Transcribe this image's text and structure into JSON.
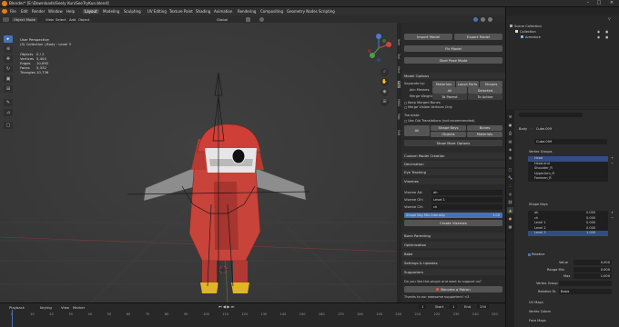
{
  "window": {
    "title": "Blender* [E:\\Downloads\\Seely Kun\\SeeTryKun.blend]"
  },
  "menu": {
    "file_items": [
      "File",
      "Edit",
      "Render",
      "Window",
      "Help"
    ],
    "workspaces": [
      "Layout",
      "Modeling",
      "Sculpting",
      "UV Editing",
      "Texture Paint",
      "Shading",
      "Animation",
      "Rendering",
      "Compositing",
      "Geometry Nodes",
      "Scripting"
    ],
    "active_workspace": "Layout",
    "scene_label": "Scene",
    "viewlayer_label": "ViewLayer"
  },
  "viewport_header": {
    "mode": "Object Mode",
    "items": [
      "View",
      "Select",
      "Add",
      "Object"
    ],
    "orientation": "Global",
    "options": "Options"
  },
  "viewport": {
    "view_name": "User Perspective",
    "collection": "(0) Collection | Body : Level 3",
    "stats": [
      {
        "label": "Objects",
        "value": "0 / 2"
      },
      {
        "label": "Vertices",
        "value": "5,404"
      },
      {
        "label": "Edges",
        "value": "10,692"
      },
      {
        "label": "Faces",
        "value": "5,332"
      },
      {
        "label": "Triangles",
        "value": "10,736"
      }
    ]
  },
  "cats_panel": {
    "import_label": "Import Model",
    "export_label": "Export Model",
    "fix_label": "Fix Model",
    "pose_label": "Start Pose Mode",
    "model_options": "Model Options",
    "separate_by": "Separate by:",
    "sep_materials": "Materials",
    "sep_loose": "Loose Parts",
    "sep_shapes": "Shapes",
    "join_meshes": "Join Meshes:",
    "join_all": "All",
    "join_selected": "Selected",
    "merge_weights": "Merge Weights:",
    "merge_to_parent": "To Parent",
    "merge_to_active": "To Active",
    "keep_merged_bones": "Keep Merged Bones",
    "merge_visible": "Merge Visible Vertices Only",
    "translate": "Translate:",
    "use_old_translations": "Use Old Translations (not recommended)",
    "tr_all": "All",
    "tr_shape_keys": "Shape Keys",
    "tr_bones": "Bones",
    "tr_objects": "Objects",
    "tr_materials": "Materials",
    "show_more": "Show More Options",
    "custom_model": "Custom Model Creation",
    "decimation": "Decimation",
    "eye_tracking": "Eye Tracking",
    "visemes": "Visemes",
    "viseme_aa_label": "Viseme AA:",
    "viseme_aa_value": "ah",
    "viseme_oh_label": "Viseme OH:",
    "viseme_oh_value": "Level 1",
    "viseme_ch_label": "Viseme CH:",
    "viseme_ch_value": "ch",
    "shape_mix_label": "Shape Key Mix Intensity",
    "shape_mix_value": "1.00",
    "create_visemes": "Create Visemes",
    "bone_parenting": "Bone Parenting",
    "optimization": "Optimization",
    "bake": "Bake",
    "settings_updates": "Settings & Updates",
    "supporters": "Supporters",
    "support_question": "Do you like this plugin and want to support us?",
    "patron": "Become a Patron",
    "thanks": "Thanks to our awesome supporters! <3"
  },
  "side_tabs": [
    "Item",
    "Tool",
    "View",
    "CATS",
    "MMD",
    "Misc",
    "Edit"
  ],
  "outliner": {
    "title": "Scene Collection",
    "items": [
      {
        "label": "Collection",
        "depth": 1
      },
      {
        "label": "Armature",
        "depth": 2
      }
    ]
  },
  "properties": {
    "breadcrumb": [
      "Body",
      "Cube.009"
    ],
    "mesh_name": "Cube.009",
    "vertex_groups_title": "Vertex Groups",
    "vertex_groups": [
      "Head",
      "Head.end",
      "Shoulder_R",
      "UpperArm_R",
      "Forearm_R"
    ],
    "shape_keys_title": "Shape Keys",
    "shape_keys": [
      {
        "name": "ah",
        "value": "0.000"
      },
      {
        "name": "ch",
        "value": "0.000"
      },
      {
        "name": "Level 1",
        "value": "0.000"
      },
      {
        "name": "Level 2",
        "value": "0.000"
      },
      {
        "name": "Level 3",
        "value": "1.000"
      }
    ],
    "relative_label": "Relative",
    "value_label": "Value",
    "value": "0.000",
    "range_min_label": "Range Min",
    "range_min": "0.000",
    "max_label": "Max",
    "max": "1.000",
    "vertex_group_label": "Vertex Group",
    "relative_to_label": "Relative To",
    "relative_to": "Basis",
    "uv_maps": "UV Maps",
    "vertex_colors": "Vertex Colors",
    "face_maps": "Face Maps"
  },
  "timeline": {
    "menu": [
      "Playback",
      "Keying",
      "View",
      "Marker"
    ],
    "ticks": [
      "0",
      "10",
      "20",
      "30",
      "40",
      "50",
      "60",
      "70",
      "80",
      "90",
      "100",
      "110",
      "120",
      "130",
      "140",
      "150",
      "160",
      "170",
      "180",
      "190",
      "200",
      "210",
      "220",
      "230",
      "240",
      "250"
    ],
    "current_frame": "1",
    "start_label": "Start",
    "start": "1",
    "end_label": "End",
    "end": "250"
  },
  "colors": {
    "accent": "#4772b3",
    "character_red": "#c8433a",
    "gray_body": "#8a8a8a"
  }
}
